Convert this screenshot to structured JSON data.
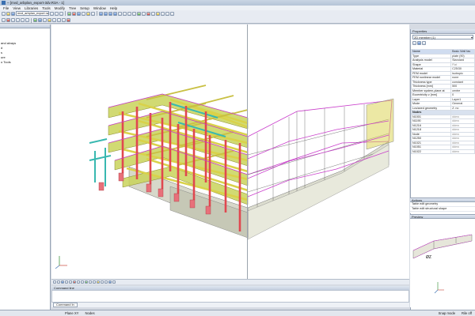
{
  "window": {
    "title": "– [mvd_arbplan_export-3dv.R3A - 1]"
  },
  "menu": [
    "File",
    "View",
    "Libraries",
    "Tools",
    "Modify",
    "Tree",
    "Setup",
    "Window",
    "Help"
  ],
  "toolbar": {
    "combo_value": "mvd_arbplan_export rab..."
  },
  "left_panel": {
    "header": "",
    "items": [
      "and alvays",
      "d",
      "",
      "s",
      "",
      "ure",
      "o Tools"
    ]
  },
  "command_line": {
    "header": "Command line",
    "tab": "Command ln"
  },
  "status_bar": {
    "plane": "Plane XY",
    "nodes": "Nodes",
    "snap_mode": "Snap mode",
    "grid": "Rile off"
  },
  "properties": {
    "header": "Properties",
    "selection": "2D member (1)",
    "rows": [
      {
        "name": "Name",
        "value": "Basic Wall fas",
        "type": "selected"
      },
      {
        "name": "Type",
        "value": "plate (90)"
      },
      {
        "name": "Analysis model",
        "value": "Standard"
      },
      {
        "name": "Shape",
        "value": "Flat",
        "grey": true
      },
      {
        "name": "Material",
        "value": "C25/30"
      },
      {
        "name": "FEM model",
        "value": "isotropic"
      },
      {
        "name": "FEM nonlinear model",
        "value": "none"
      },
      {
        "name": "Thickness type",
        "value": "constant"
      },
      {
        "name": "Thickness [mm]",
        "value": "500"
      },
      {
        "name": "Member system-plane at",
        "value": "centre"
      },
      {
        "name": "Eccentricity z [mm]",
        "value": "0"
      },
      {
        "name": "Layer",
        "value": "Layer1"
      },
      {
        "name": "Mode",
        "value": "General"
      },
      {
        "name": "Lcs/axed geometry",
        "value": "Z: no"
      },
      {
        "name": "Nodes",
        "value": "",
        "type": "group"
      },
      {
        "name": "N1001",
        "value": "ddew",
        "grey": true
      },
      {
        "name": "N1190",
        "value": "ddew",
        "grey": true
      },
      {
        "name": "N1216",
        "value": "ddew",
        "grey": true
      },
      {
        "name": "N1218",
        "value": "ddew",
        "grey": true
      },
      {
        "name": "Node",
        "value": "ddew",
        "grey": true
      },
      {
        "name": "N1250",
        "value": "ddew",
        "grey": true
      },
      {
        "name": "N1021",
        "value": "ddew",
        "grey": true
      },
      {
        "name": "N1051",
        "value": "ddew",
        "grey": true
      },
      {
        "name": "N1022",
        "value": "ddew",
        "grey": true
      }
    ]
  },
  "actions": {
    "header": "Actions",
    "items": [
      "Table edit geometry",
      "Table edit structural shape"
    ]
  },
  "preview": {
    "header": "Preview",
    "label": "ØZ"
  },
  "colors": {
    "column": "#e0474f",
    "beam": "#d9d24a",
    "slab": "#c9d45a",
    "brace": "#38b8b0",
    "wall": "#dcddcf",
    "edge": "#c93dcb",
    "footing": "#e8707a"
  }
}
